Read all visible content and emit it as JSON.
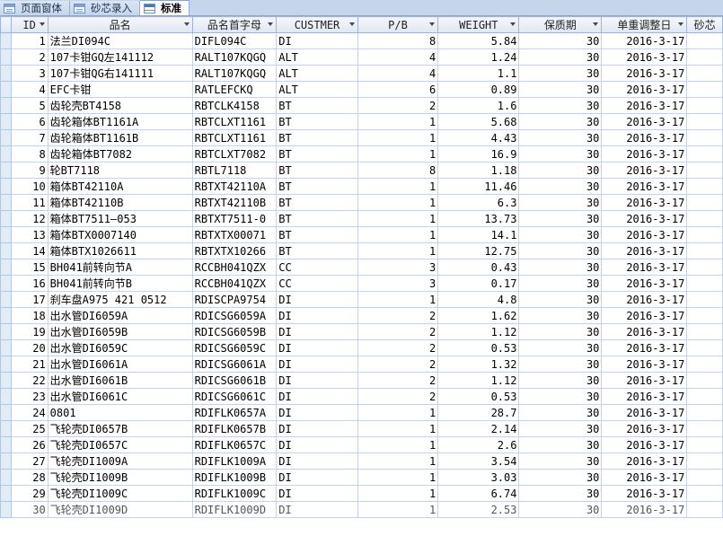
{
  "tabs": [
    {
      "label": "页面窗体",
      "icon": "form-icon",
      "active": false
    },
    {
      "label": "砂芯录入",
      "icon": "form-icon",
      "active": false
    },
    {
      "label": "标准",
      "icon": "table-icon",
      "active": true
    }
  ],
  "columns": [
    "ID",
    "品名",
    "品名首字母",
    "CUSTMER",
    "P/B",
    "WEIGHT",
    "保质期",
    "单重调整日",
    "砂芯"
  ],
  "rows": [
    {
      "id": "1",
      "name": "法兰DI094C",
      "code": "DIFL094C",
      "cust": "DI",
      "pb": "8",
      "weight": "5.84",
      "shelf": "30",
      "date": "2016-3-17"
    },
    {
      "id": "2",
      "name": "107卡钳GQ左141112",
      "code": "RALT107KQGQ",
      "cust": "ALT",
      "pb": "4",
      "weight": "1.24",
      "shelf": "30",
      "date": "2016-3-17"
    },
    {
      "id": "3",
      "name": "107卡钳QG右141111",
      "code": "RALT107KQGQ",
      "cust": "ALT",
      "pb": "4",
      "weight": "1.1",
      "shelf": "30",
      "date": "2016-3-17"
    },
    {
      "id": "4",
      "name": "EFC卡钳",
      "code": "RATLEFCKQ",
      "cust": "ALT",
      "pb": "6",
      "weight": "0.89",
      "shelf": "30",
      "date": "2016-3-17"
    },
    {
      "id": "5",
      "name": "齿轮壳BT4158",
      "code": "RBTCLK4158",
      "cust": "BT",
      "pb": "2",
      "weight": "1.6",
      "shelf": "30",
      "date": "2016-3-17"
    },
    {
      "id": "6",
      "name": "齿轮箱体BT1161A",
      "code": "RBTCLXT1161",
      "cust": "BT",
      "pb": "1",
      "weight": "5.68",
      "shelf": "30",
      "date": "2016-3-17"
    },
    {
      "id": "7",
      "name": "齿轮箱体BT1161B",
      "code": "RBTCLXT1161",
      "cust": "BT",
      "pb": "1",
      "weight": "4.43",
      "shelf": "30",
      "date": "2016-3-17"
    },
    {
      "id": "8",
      "name": "齿轮箱体BT7082",
      "code": "RBTCLXT7082",
      "cust": "BT",
      "pb": "1",
      "weight": "16.9",
      "shelf": "30",
      "date": "2016-3-17"
    },
    {
      "id": "9",
      "name": "轮BT7118",
      "code": "RBTL7118",
      "cust": "BT",
      "pb": "8",
      "weight": "1.18",
      "shelf": "30",
      "date": "2016-3-17"
    },
    {
      "id": "10",
      "name": "箱体BT42110A",
      "code": "RBTXT42110A",
      "cust": "BT",
      "pb": "1",
      "weight": "11.46",
      "shelf": "30",
      "date": "2016-3-17"
    },
    {
      "id": "11",
      "name": "箱体BT42110B",
      "code": "RBTXT42110B",
      "cust": "BT",
      "pb": "1",
      "weight": "6.3",
      "shelf": "30",
      "date": "2016-3-17"
    },
    {
      "id": "12",
      "name": "箱体BT7511—053",
      "code": "RBTXT7511-0",
      "cust": "BT",
      "pb": "1",
      "weight": "13.73",
      "shelf": "30",
      "date": "2016-3-17"
    },
    {
      "id": "13",
      "name": "箱体BTX0007140",
      "code": "RBTXTX00071",
      "cust": "BT",
      "pb": "1",
      "weight": "14.1",
      "shelf": "30",
      "date": "2016-3-17"
    },
    {
      "id": "14",
      "name": "箱体BTX1026611",
      "code": "RBTXTX10266",
      "cust": "BT",
      "pb": "1",
      "weight": "12.75",
      "shelf": "30",
      "date": "2016-3-17"
    },
    {
      "id": "15",
      "name": "BH041前转向节A",
      "code": "RCCBH041QZX",
      "cust": "CC",
      "pb": "3",
      "weight": "0.43",
      "shelf": "30",
      "date": "2016-3-17"
    },
    {
      "id": "16",
      "name": "BH041前转向节B",
      "code": "RCCBH041QZX",
      "cust": "CC",
      "pb": "3",
      "weight": "0.17",
      "shelf": "30",
      "date": "2016-3-17"
    },
    {
      "id": "17",
      "name": "刹车盘A975 421 0512",
      "code": "RDISCPA9754",
      "cust": "DI",
      "pb": "1",
      "weight": "4.8",
      "shelf": "30",
      "date": "2016-3-17"
    },
    {
      "id": "18",
      "name": "出水管DI6059A",
      "code": "RDICSG6059A",
      "cust": "DI",
      "pb": "2",
      "weight": "1.62",
      "shelf": "30",
      "date": "2016-3-17"
    },
    {
      "id": "19",
      "name": "出水管DI6059B",
      "code": "RDICSG6059B",
      "cust": "DI",
      "pb": "2",
      "weight": "1.12",
      "shelf": "30",
      "date": "2016-3-17"
    },
    {
      "id": "20",
      "name": "出水管DI6059C",
      "code": "RDICSG6059C",
      "cust": "DI",
      "pb": "2",
      "weight": "0.53",
      "shelf": "30",
      "date": "2016-3-17"
    },
    {
      "id": "21",
      "name": "出水管DI6061A",
      "code": "RDICSG6061A",
      "cust": "DI",
      "pb": "2",
      "weight": "1.32",
      "shelf": "30",
      "date": "2016-3-17"
    },
    {
      "id": "22",
      "name": "出水管DI6061B",
      "code": "RDICSG6061B",
      "cust": "DI",
      "pb": "2",
      "weight": "1.12",
      "shelf": "30",
      "date": "2016-3-17"
    },
    {
      "id": "23",
      "name": "出水管DI6061C",
      "code": "RDICSG6061C",
      "cust": "DI",
      "pb": "2",
      "weight": "0.53",
      "shelf": "30",
      "date": "2016-3-17"
    },
    {
      "id": "24",
      "name": "0801",
      "code": "RDIFLK0657A",
      "cust": "DI",
      "pb": "1",
      "weight": "28.7",
      "shelf": "30",
      "date": "2016-3-17"
    },
    {
      "id": "25",
      "name": "飞轮壳DI0657B",
      "code": "RDIFLK0657B",
      "cust": "DI",
      "pb": "1",
      "weight": "2.14",
      "shelf": "30",
      "date": "2016-3-17"
    },
    {
      "id": "26",
      "name": "飞轮壳DI0657C",
      "code": "RDIFLK0657C",
      "cust": "DI",
      "pb": "1",
      "weight": "2.6",
      "shelf": "30",
      "date": "2016-3-17"
    },
    {
      "id": "27",
      "name": "飞轮壳DI1009A",
      "code": "RDIFLK1009A",
      "cust": "DI",
      "pb": "1",
      "weight": "3.54",
      "shelf": "30",
      "date": "2016-3-17"
    },
    {
      "id": "28",
      "name": "飞轮壳DI1009B",
      "code": "RDIFLK1009B",
      "cust": "DI",
      "pb": "1",
      "weight": "3.03",
      "shelf": "30",
      "date": "2016-3-17"
    },
    {
      "id": "29",
      "name": "飞轮壳DI1009C",
      "code": "RDIFLK1009C",
      "cust": "DI",
      "pb": "1",
      "weight": "6.74",
      "shelf": "30",
      "date": "2016-3-17"
    },
    {
      "id": "30",
      "name": "飞轮壳DI1009D",
      "code": "RDIFLK1009D",
      "cust": "DI",
      "pb": "1",
      "weight": "2.53",
      "shelf": "30",
      "date": "2016-3-17"
    }
  ]
}
